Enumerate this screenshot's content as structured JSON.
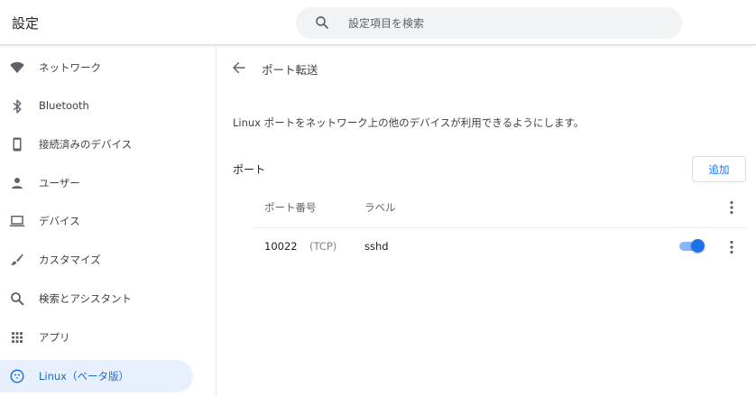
{
  "header": {
    "title": "設定",
    "search_placeholder": "設定項目を検索",
    "search_icon": "search-icon"
  },
  "sidebar": {
    "items": [
      {
        "label": "ネットワーク",
        "icon": "wifi-icon"
      },
      {
        "label": "Bluetooth",
        "icon": "bluetooth-icon"
      },
      {
        "label": "接続済みのデバイス",
        "icon": "phone-icon"
      },
      {
        "label": "ユーザー",
        "icon": "person-icon"
      },
      {
        "label": "デバイス",
        "icon": "laptop-icon"
      },
      {
        "label": "カスタマイズ",
        "icon": "brush-icon"
      },
      {
        "label": "検索とアシスタント",
        "icon": "search-icon"
      },
      {
        "label": "アプリ",
        "icon": "apps-grid-icon"
      },
      {
        "label": "Linux（ベータ版）",
        "icon": "penguin-icon",
        "active": true
      }
    ]
  },
  "main": {
    "title": "ポート転送",
    "description": "Linux ポートをネットワーク上の他のデバイスが利用できるようにします。",
    "section_title": "ポート",
    "add_label": "追加",
    "columns": {
      "port": "ポート番号",
      "label": "ラベル"
    },
    "rows": [
      {
        "port": "10022",
        "protocol": "(TCP)",
        "label": "sshd",
        "enabled": true
      }
    ]
  },
  "colors": {
    "accent": "#1a73e8",
    "active_bg": "#e8f0fe",
    "toggle_track": "#8ab4f8"
  }
}
